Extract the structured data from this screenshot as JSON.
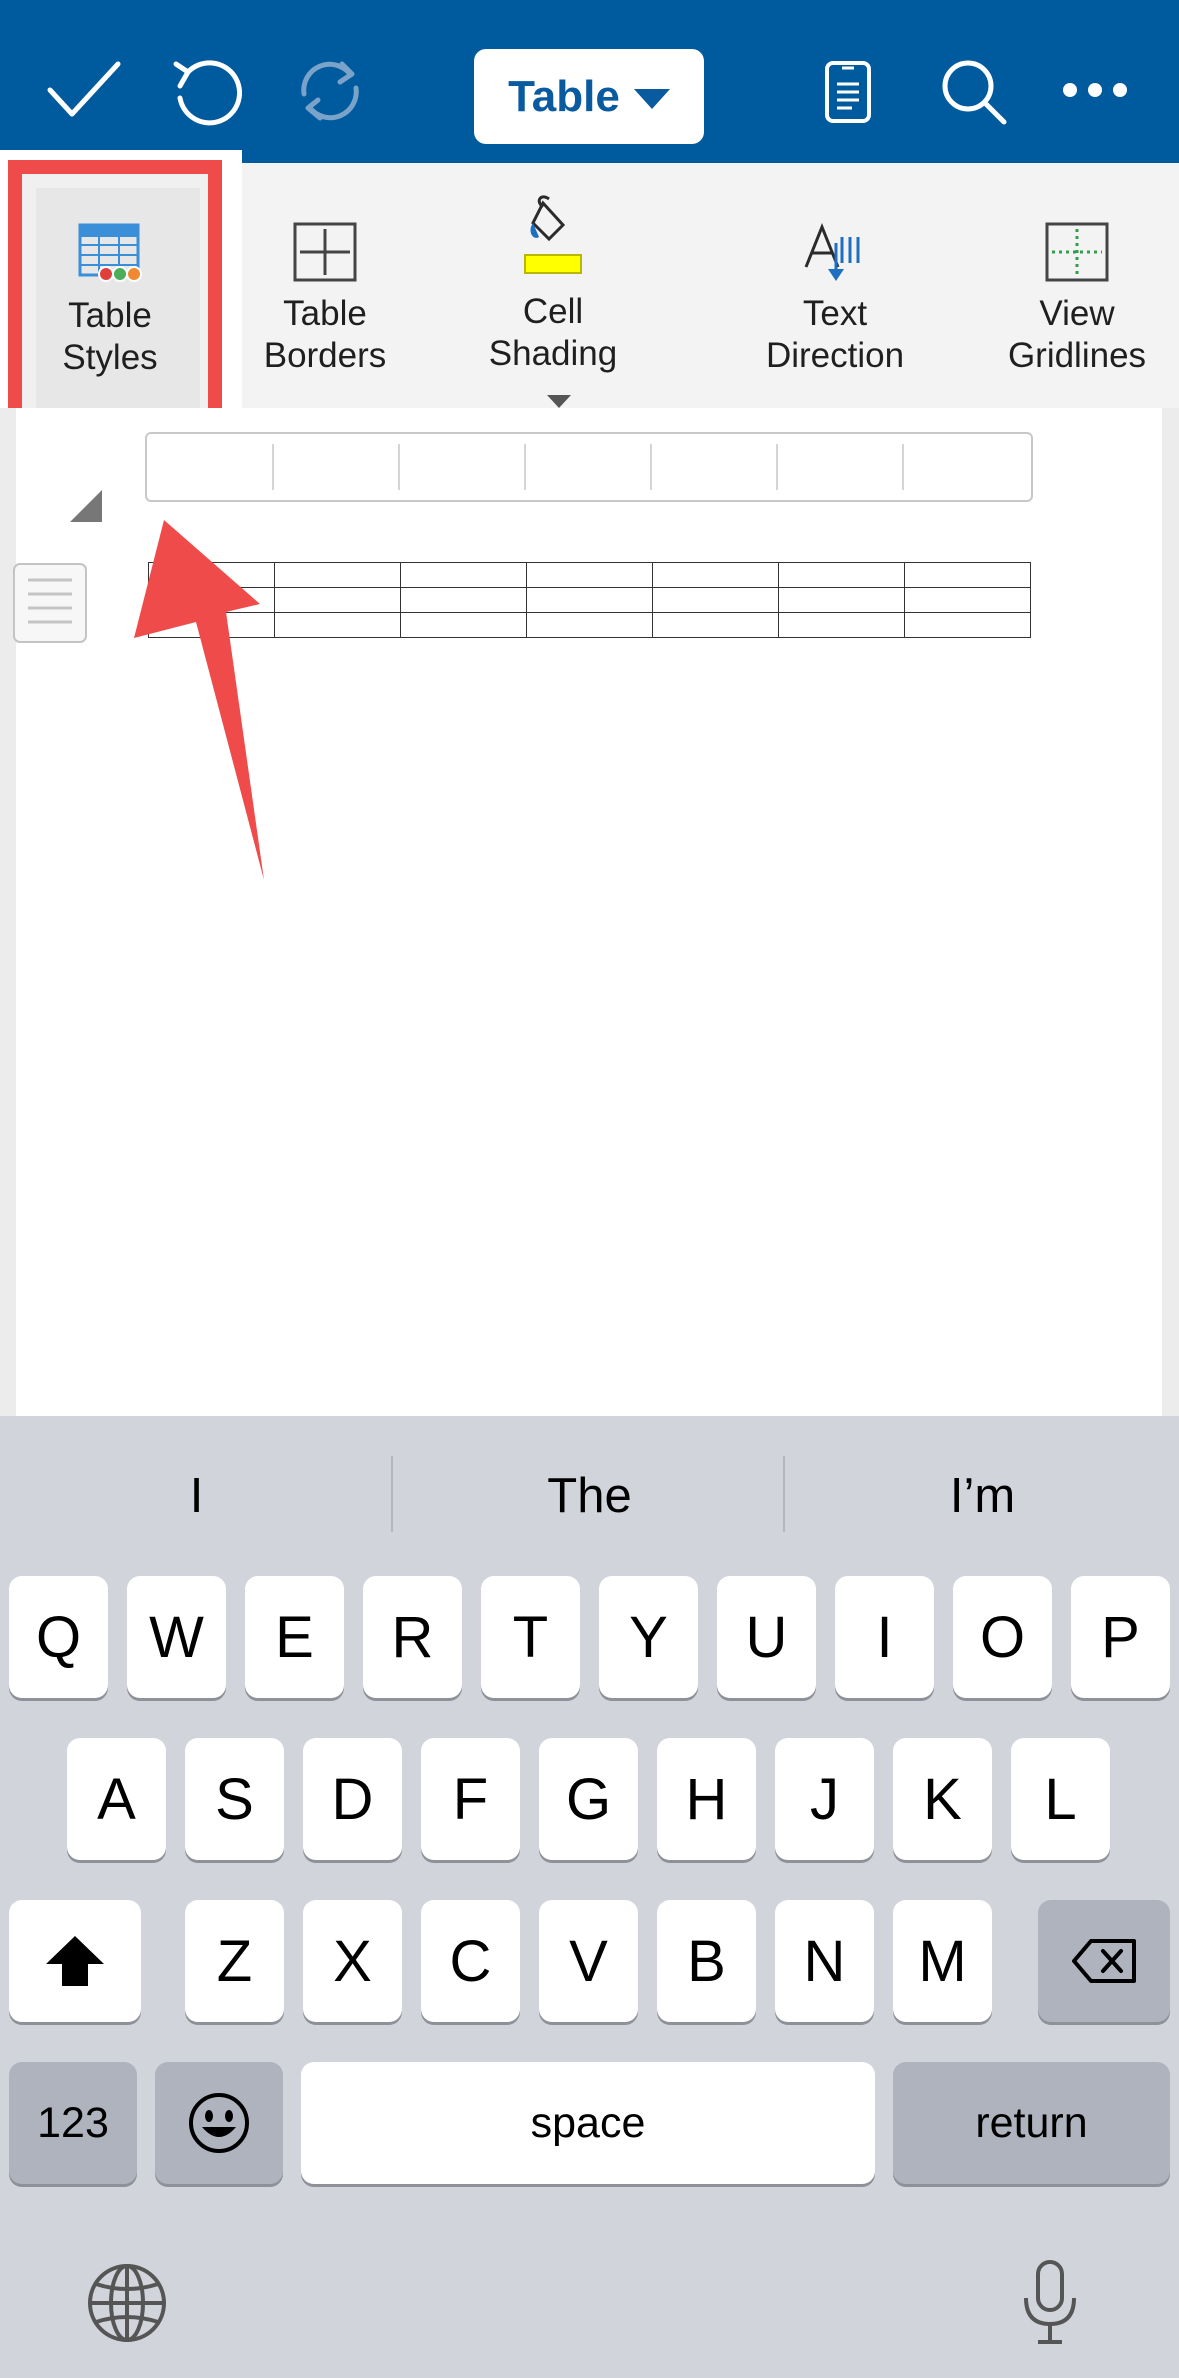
{
  "toolbar": {
    "mode_label": "Table",
    "icons": [
      "checkmark-icon",
      "undo-icon",
      "redo-icon",
      "chevron-down-icon",
      "mobile-view-icon",
      "search-icon",
      "more-icon"
    ]
  },
  "ribbon": {
    "items": [
      {
        "name": "table-styles",
        "line1": "Table",
        "line2": "Styles",
        "icon": "table-styles-icon"
      },
      {
        "name": "table-borders",
        "line1": "Table",
        "line2": "Borders",
        "icon": "table-borders-icon"
      },
      {
        "name": "cell-shading",
        "line1": "Cell",
        "line2": "Shading",
        "icon": "paint-bucket-icon"
      },
      {
        "name": "text-direction",
        "line1": "Text",
        "line2": "Direction",
        "icon": "text-direction-icon"
      },
      {
        "name": "view-gridlines",
        "line1": "View",
        "line2": "Gridlines",
        "icon": "gridlines-icon"
      }
    ],
    "highlighted": "table-styles",
    "highlight_color": "#ef4b4b"
  },
  "colors": {
    "header_bg": "#005a9e",
    "accent": "#0a5aa0",
    "shading_yellow": "#ffff00",
    "keyboard_bg": "#d1d4db"
  },
  "keyboard": {
    "suggestions": [
      "I",
      "The",
      "I’m"
    ],
    "row1": [
      "Q",
      "W",
      "E",
      "R",
      "T",
      "Y",
      "U",
      "I",
      "O",
      "P"
    ],
    "row2": [
      "A",
      "S",
      "D",
      "F",
      "G",
      "H",
      "J",
      "K",
      "L"
    ],
    "row3": [
      "Z",
      "X",
      "C",
      "V",
      "B",
      "N",
      "M"
    ],
    "numbers_label": "123",
    "space_label": "space",
    "return_label": "return"
  }
}
